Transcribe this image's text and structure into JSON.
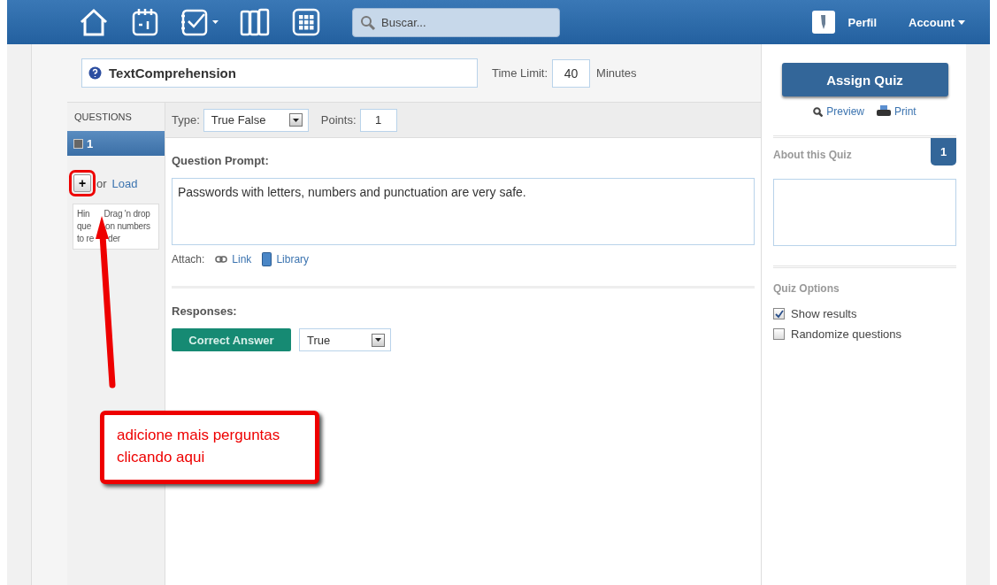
{
  "nav": {
    "search": {
      "placeholder": "Buscar..."
    },
    "profile": "Perfil",
    "account": "Account"
  },
  "quiz": {
    "title": "TextComprehension",
    "time_limit_label": "Time Limit:",
    "time_limit": "40",
    "minutes": "Minutes"
  },
  "questions": {
    "heading": "QUESTIONS",
    "items": [
      {
        "label": "1",
        "selected": true,
        "checked": false
      }
    ],
    "add": "+",
    "or": "or",
    "load": "Load",
    "hint_lines": [
      [
        "Hin",
        "Drag 'n drop"
      ],
      [
        "que",
        "on numbers"
      ],
      [
        "to re",
        "der"
      ]
    ]
  },
  "editor": {
    "type_label": "Type:",
    "type": "True False",
    "points_label": "Points:",
    "points": "1",
    "prompt_label": "Question Prompt:",
    "prompt": "Passwords with letters, numbers and punctuation are very safe.",
    "attach_label": "Attach:",
    "attach": [
      {
        "kind": "link",
        "label": "Link"
      },
      {
        "kind": "library",
        "label": "Library"
      }
    ],
    "responses_label": "Responses:",
    "correct_answer": "Correct Answer",
    "answer": "True"
  },
  "sidebar": {
    "assign": "Assign Quiz",
    "preview": "Preview",
    "print": "Print",
    "about": "About this Quiz",
    "count": "1",
    "options_heading": "Quiz Options",
    "options": [
      {
        "label": "Show results",
        "checked": true
      },
      {
        "label": "Randomize questions",
        "checked": false
      }
    ]
  },
  "annotation": {
    "text": "adicione mais perguntas clicando aqui"
  }
}
